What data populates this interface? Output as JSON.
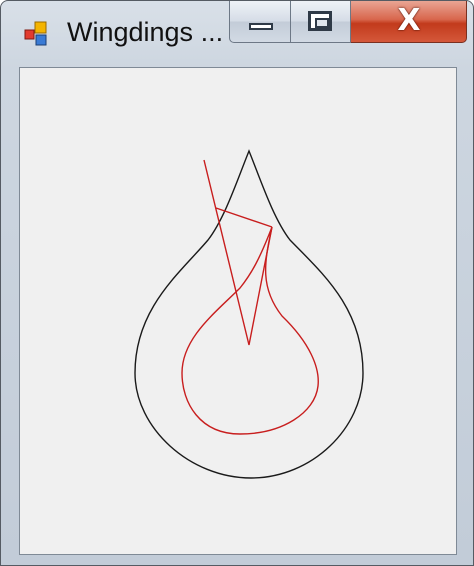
{
  "window": {
    "title": "Wingdings ...",
    "app_icon": "app-window-icon",
    "buttons": {
      "minimize": "minimize-icon",
      "maximize": "maximize-icon",
      "close_glyph": "X"
    }
  },
  "colors": {
    "outer_curve": "#1a1a1a",
    "inner_curve": "#c81e1e",
    "client_background": "#f0f0f0"
  }
}
